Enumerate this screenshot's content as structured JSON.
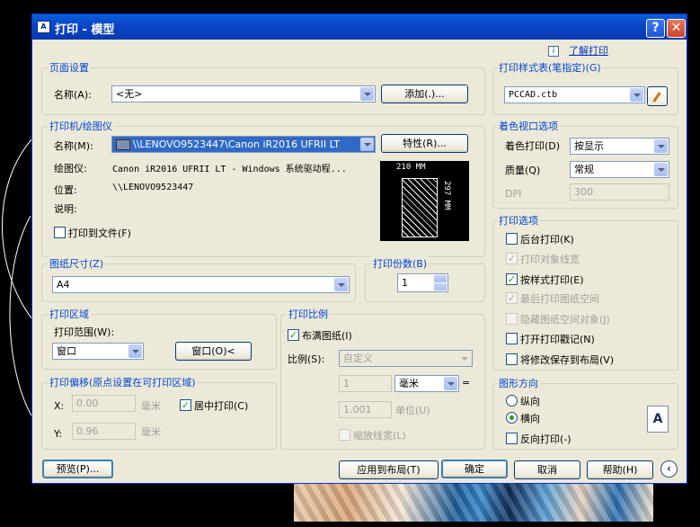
{
  "window": {
    "title": "打印 - 模型",
    "app_icon": "autocad-icon"
  },
  "help_link": "了解打印",
  "page_setup": {
    "group": "页面设置",
    "name_label": "名称(A):",
    "name_value": "<无>",
    "add_button": "添加(.)..."
  },
  "printer": {
    "group": "打印机/绘图仪",
    "name_label": "名称(M):",
    "name_value": "\\\\LENOVO9523447\\Canon iR2016 UFRII LT",
    "properties_button": "特性(R)...",
    "plotter_label": "绘图仪:",
    "plotter_value": "Canon iR2016 UFRII LT - Windows 系统驱动程...",
    "location_label": "位置:",
    "location_value": "\\\\LENOVO9523447",
    "desc_label": "说明:",
    "print_to_file": "打印到文件(F)",
    "preview_width": "210 MM",
    "preview_height": "297 MM"
  },
  "paper_size": {
    "group": "图纸尺寸(Z)",
    "value": "A4"
  },
  "copies": {
    "group": "打印份数(B)",
    "value": "1"
  },
  "plot_area": {
    "group": "打印区域",
    "range_label": "打印范围(W):",
    "range_value": "窗口",
    "window_button": "窗口(O)<"
  },
  "plot_offset": {
    "group": "打印偏移(原点设置在可打印区域)",
    "x_label": "X:",
    "x_value": "0.00",
    "x_unit": "毫米",
    "y_label": "Y:",
    "y_value": "0.96",
    "y_unit": "毫米",
    "center_label": "居中打印(C)"
  },
  "plot_scale": {
    "group": "打印比例",
    "fit_label": "布满图纸(I)",
    "scale_label": "比例(S):",
    "scale_value": "自定义",
    "val1": "1",
    "unit": "毫米",
    "equals": "=",
    "val2": "1.001",
    "unit2": "单位(U)",
    "lineweights": "缩放线宽(L)"
  },
  "style_table": {
    "group": "打印样式表(笔指定)(G)",
    "value": "PCCAD.ctb"
  },
  "shaded_viewport": {
    "group": "着色视口选项",
    "shade_label": "着色打印(D)",
    "shade_value": "按显示",
    "quality_label": "质量(Q)",
    "quality_value": "常规",
    "dpi_label": "DPI",
    "dpi_value": "300"
  },
  "plot_options": {
    "group": "打印选项",
    "items": [
      "后台打印(K)",
      "打印对象线宽",
      "按样式打印(E)",
      "最后打印图纸空间",
      "隐藏图纸空间对象(J)",
      "打开打印戳记(N)",
      "将修改保存到布局(V)"
    ]
  },
  "orientation": {
    "group": "图形方向",
    "portrait": "纵向",
    "landscape": "横向",
    "upside_down": "反向打印(-)",
    "icon_letter": "A"
  },
  "footer": {
    "preview": "预览(P)...",
    "apply": "应用到布局(T)",
    "ok": "确定",
    "cancel": "取消",
    "help": "帮助(H)"
  }
}
